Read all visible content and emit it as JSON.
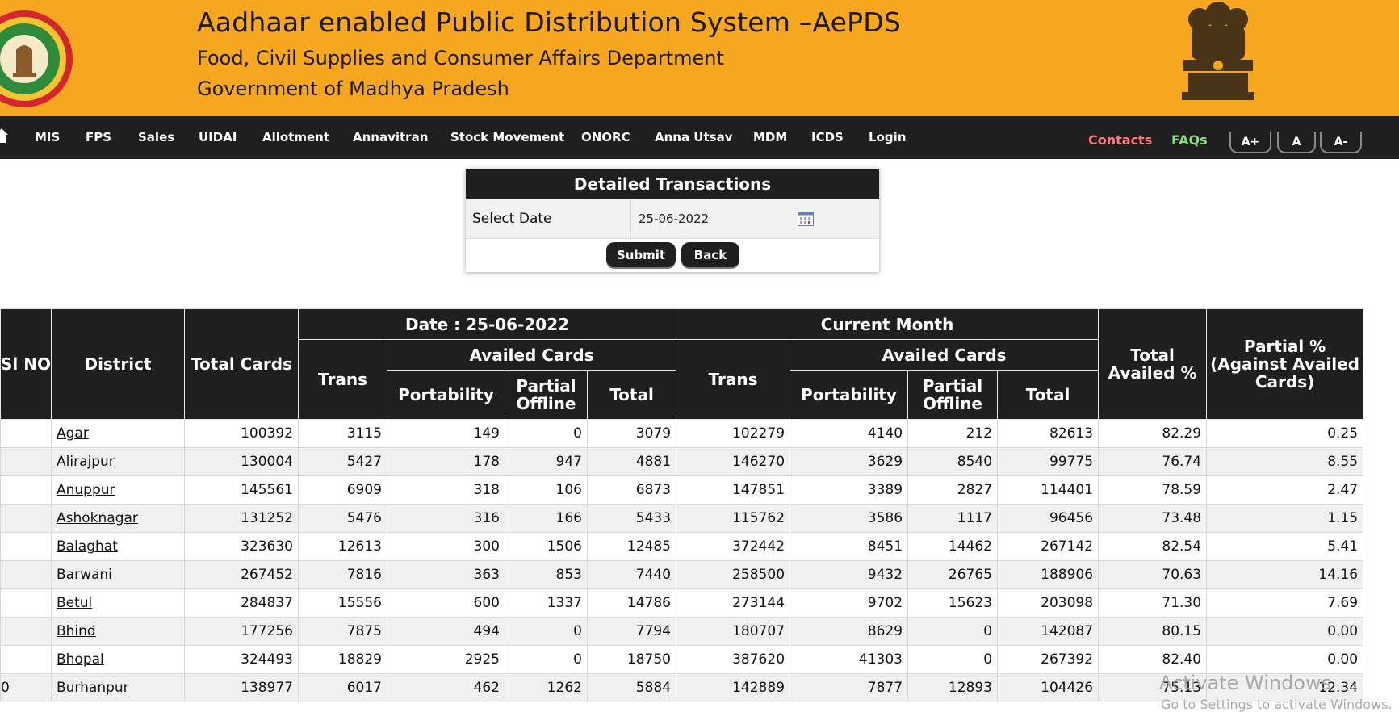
{
  "header": {
    "title": "Aadhaar enabled Public Distribution System –AePDS",
    "subtitle1": "Food, Civil Supplies and Consumer Affairs Department",
    "subtitle2": "Government of Madhya Pradesh"
  },
  "colors": {
    "header_bg": "#f7a620",
    "nav_bg": "#1f1f1f",
    "contacts": "#ff7a7a",
    "faqs": "#86e07a"
  },
  "nav": {
    "home_icon": "home-icon",
    "items": [
      "MIS",
      "FPS",
      "Sales",
      "UIDAI",
      "Allotment",
      "Annavitran",
      "Stock Movement",
      "ONORC",
      "Anna Utsav",
      "MDM",
      "ICDS",
      "Login"
    ],
    "contacts": "Contacts",
    "faqs": "FAQs",
    "font_buttons": [
      "A+",
      "A",
      "A-"
    ]
  },
  "form": {
    "title": "Detailed Transactions",
    "date_label": "Select Date",
    "date_value": "25-06-2022",
    "submit": "Submit",
    "back": "Back"
  },
  "table": {
    "headers": {
      "sl_no": "Sl NO",
      "district": "District",
      "total_cards": "Total Cards",
      "date_group": "Date : 25-06-2022",
      "month_group": "Current Month",
      "trans": "Trans",
      "availed_cards": "Availed Cards",
      "portability": "Portability",
      "partial_offline": "Partial Offline",
      "total": "Total",
      "total_availed_pct": "Total Availed %",
      "partial_pct": "Partial % (Against Availed Cards)"
    },
    "rows": [
      {
        "sl": "",
        "district": "Agar",
        "total_cards": "100392",
        "d_trans": "3115",
        "d_port": "149",
        "d_partial": "0",
        "d_total": "3079",
        "m_trans": "102279",
        "m_port": "4140",
        "m_partial": "212",
        "m_total": "82613",
        "availed_pct": "82.29",
        "partial_pct": "0.25"
      },
      {
        "sl": "",
        "district": "Alirajpur",
        "total_cards": "130004",
        "d_trans": "5427",
        "d_port": "178",
        "d_partial": "947",
        "d_total": "4881",
        "m_trans": "146270",
        "m_port": "3629",
        "m_partial": "8540",
        "m_total": "99775",
        "availed_pct": "76.74",
        "partial_pct": "8.55"
      },
      {
        "sl": "",
        "district": "Anuppur",
        "total_cards": "145561",
        "d_trans": "6909",
        "d_port": "318",
        "d_partial": "106",
        "d_total": "6873",
        "m_trans": "147851",
        "m_port": "3389",
        "m_partial": "2827",
        "m_total": "114401",
        "availed_pct": "78.59",
        "partial_pct": "2.47"
      },
      {
        "sl": "",
        "district": "Ashoknagar",
        "total_cards": "131252",
        "d_trans": "5476",
        "d_port": "316",
        "d_partial": "166",
        "d_total": "5433",
        "m_trans": "115762",
        "m_port": "3586",
        "m_partial": "1117",
        "m_total": "96456",
        "availed_pct": "73.48",
        "partial_pct": "1.15"
      },
      {
        "sl": "",
        "district": "Balaghat",
        "total_cards": "323630",
        "d_trans": "12613",
        "d_port": "300",
        "d_partial": "1506",
        "d_total": "12485",
        "m_trans": "372442",
        "m_port": "8451",
        "m_partial": "14462",
        "m_total": "267142",
        "availed_pct": "82.54",
        "partial_pct": "5.41"
      },
      {
        "sl": "",
        "district": "Barwani",
        "total_cards": "267452",
        "d_trans": "7816",
        "d_port": "363",
        "d_partial": "853",
        "d_total": "7440",
        "m_trans": "258500",
        "m_port": "9432",
        "m_partial": "26765",
        "m_total": "188906",
        "availed_pct": "70.63",
        "partial_pct": "14.16"
      },
      {
        "sl": "",
        "district": "Betul",
        "total_cards": "284837",
        "d_trans": "15556",
        "d_port": "600",
        "d_partial": "1337",
        "d_total": "14786",
        "m_trans": "273144",
        "m_port": "9702",
        "m_partial": "15623",
        "m_total": "203098",
        "availed_pct": "71.30",
        "partial_pct": "7.69"
      },
      {
        "sl": "",
        "district": "Bhind",
        "total_cards": "177256",
        "d_trans": "7875",
        "d_port": "494",
        "d_partial": "0",
        "d_total": "7794",
        "m_trans": "180707",
        "m_port": "8629",
        "m_partial": "0",
        "m_total": "142087",
        "availed_pct": "80.15",
        "partial_pct": "0.00"
      },
      {
        "sl": "",
        "district": "Bhopal",
        "total_cards": "324493",
        "d_trans": "18829",
        "d_port": "2925",
        "d_partial": "0",
        "d_total": "18750",
        "m_trans": "387620",
        "m_port": "41303",
        "m_partial": "0",
        "m_total": "267392",
        "availed_pct": "82.40",
        "partial_pct": "0.00"
      },
      {
        "sl": "0",
        "district": "Burhanpur",
        "total_cards": "138977",
        "d_trans": "6017",
        "d_port": "462",
        "d_partial": "1262",
        "d_total": "5884",
        "m_trans": "142889",
        "m_port": "7877",
        "m_partial": "12893",
        "m_total": "104426",
        "availed_pct": "75.13",
        "partial_pct": "12.34"
      }
    ]
  },
  "watermark": {
    "line1": "Activate Windows",
    "line2": "Go to Settings to activate Windows."
  }
}
